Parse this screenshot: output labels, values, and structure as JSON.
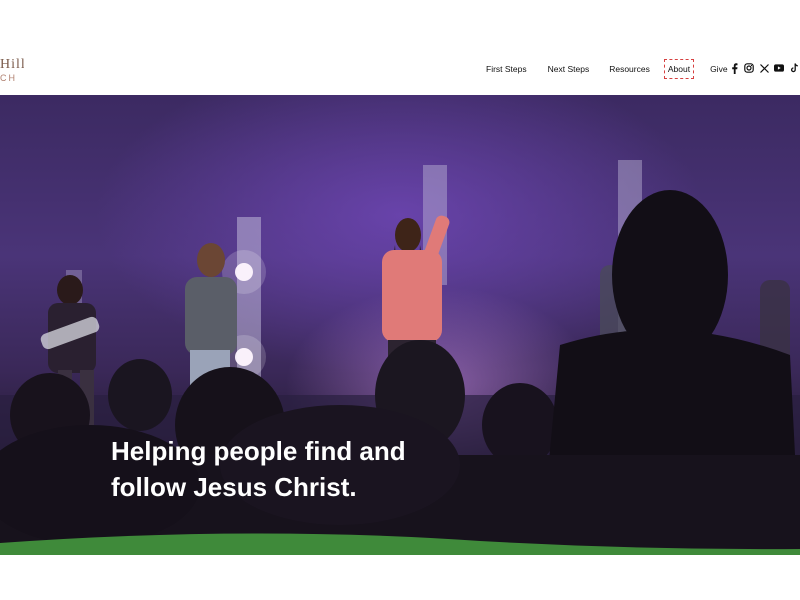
{
  "logo": {
    "line1": "Hill",
    "line2": "CH"
  },
  "nav": {
    "items": [
      "First Steps",
      "Next Steps",
      "Resources"
    ],
    "about": "About",
    "give": "Give"
  },
  "socials": [
    "facebook-icon",
    "instagram-icon",
    "x-icon",
    "youtube-icon",
    "tiktok-icon"
  ],
  "hero": {
    "headline_line1": "Helping people find and",
    "headline_line2": "follow Jesus Christ."
  },
  "colors": {
    "wave_green": "#3f8a3a",
    "stage_purple": "#4a3478"
  }
}
